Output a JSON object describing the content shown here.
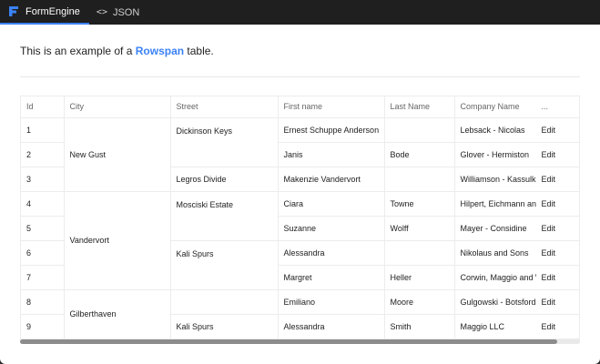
{
  "tabs": [
    {
      "label": "FormEngine",
      "icon": "formengine-logo-icon",
      "active": true
    },
    {
      "label": "JSON",
      "icon": "code-icon",
      "active": false
    }
  ],
  "intro": {
    "prefix": "This is an example of a ",
    "highlight": "Rowspan",
    "suffix": " table."
  },
  "colors": {
    "accent": "#3b82f6",
    "topbar": "#1f1f1f"
  },
  "table": {
    "headers": [
      "Id",
      "City",
      "Street",
      "First name",
      "Last Name",
      "Company Name",
      "..."
    ],
    "rows": [
      {
        "id": "1",
        "city": "New Gust",
        "street": "Dickinson Keys",
        "first": "Ernest Schuppe Anderson",
        "last": "",
        "company": "Lebsack - Nicolas",
        "action": "Edit"
      },
      {
        "id": "2",
        "first": "Janis",
        "last": "Bode",
        "company": "Glover - Hermiston",
        "action": "Edit"
      },
      {
        "id": "3",
        "street": "Legros Divide",
        "first": "Makenzie Vandervort",
        "last": "",
        "company": "Williamson - Kassulke",
        "action": "Edit"
      },
      {
        "id": "4",
        "city": "Vandervort",
        "street": "Mosciski Estate",
        "first": "Ciara",
        "last": "Towne",
        "company": "Hilpert, Eichmann and",
        "action": "Edit"
      },
      {
        "id": "5",
        "first": "Suzanne",
        "last": "Wolff",
        "company": "Mayer - Considine",
        "action": "Edit"
      },
      {
        "id": "6",
        "street": "Kali Spurs",
        "first": "Alessandra",
        "last": "",
        "company": "Nikolaus and Sons",
        "action": "Edit"
      },
      {
        "id": "7",
        "first": "Margret",
        "last": "Heller",
        "company": "Corwin, Maggio and W",
        "action": "Edit"
      },
      {
        "id": "8",
        "city": "Gilberthaven",
        "street": "",
        "first": "Emiliano",
        "last": "Moore",
        "company": "Gulgowski - Botsford",
        "action": "Edit"
      },
      {
        "id": "9",
        "street": "Kali Spurs",
        "first": "Alessandra",
        "last": "Smith",
        "company": "Maggio LLC",
        "action": "Edit"
      }
    ]
  }
}
